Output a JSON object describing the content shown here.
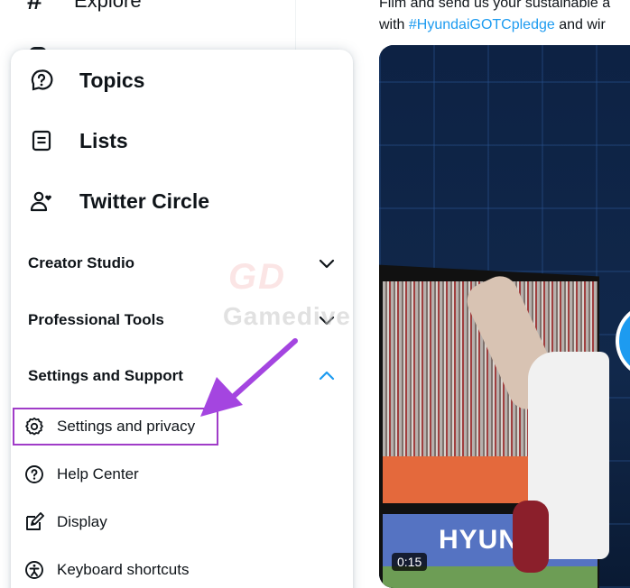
{
  "nav": {
    "explore_label": "Explore"
  },
  "menu": {
    "big_items": [
      {
        "label": "Topics",
        "icon": "topics-icon"
      },
      {
        "label": "Lists",
        "icon": "lists-icon"
      },
      {
        "label": "Twitter Circle",
        "icon": "twitter-circle-icon"
      }
    ],
    "sections": [
      {
        "label": "Creator Studio",
        "expanded": false
      },
      {
        "label": "Professional Tools",
        "expanded": false
      },
      {
        "label": "Settings and Support",
        "expanded": true
      }
    ],
    "sub_items": [
      {
        "label": "Settings and privacy",
        "icon": "gear-icon"
      },
      {
        "label": "Help Center",
        "icon": "help-icon"
      },
      {
        "label": "Display",
        "icon": "display-icon"
      },
      {
        "label": "Keyboard shortcuts",
        "icon": "keyboard-icon"
      }
    ]
  },
  "tweet": {
    "line1": "Film and send us your sustainable a",
    "line2_prefix": "with ",
    "hashtag": "#HyundaiGOTCpledge",
    "line2_suffix": " and wir",
    "video_time": "0:15",
    "ad_text": "HYUND"
  },
  "colors": {
    "accent": "#1d9bf0",
    "highlight": "#a03cc8",
    "arrow": "#a445e0",
    "text": "#0f1419"
  }
}
